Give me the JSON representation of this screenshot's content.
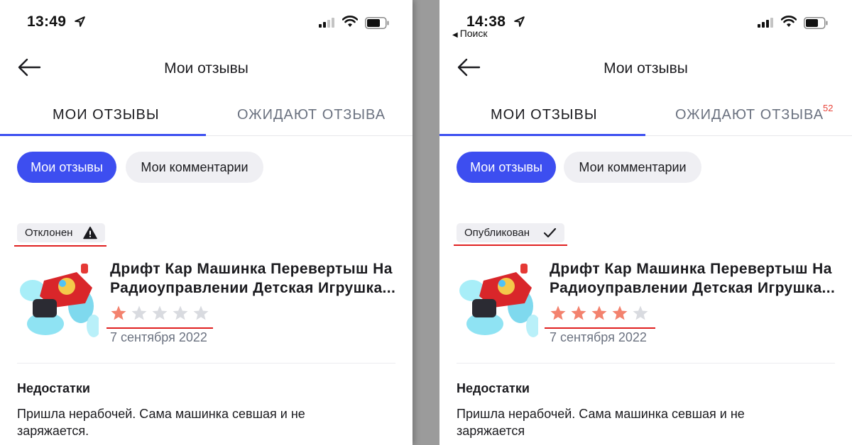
{
  "colors": {
    "accent": "#3d4ef0",
    "star_filled": "#f3826e",
    "star_empty": "#d9dbe0",
    "annotation_red": "#e02020",
    "badge_red": "#e8443a"
  },
  "screens": [
    {
      "status_bar": {
        "time": "13:49",
        "back_app": ""
      },
      "header": {
        "title": "Мои отзывы"
      },
      "tabs": [
        {
          "label": "Мои отзывы",
          "active": true
        },
        {
          "label": "Ожидают отзыва",
          "active": false,
          "badge": ""
        }
      ],
      "pills": [
        {
          "label": "Мои отзывы",
          "active": true
        },
        {
          "label": "Мои комментарии",
          "active": false
        }
      ],
      "review": {
        "status": "Отклонен",
        "status_icon": "warning-icon",
        "product_title": "Дрифт Кар Машинка Перевертыш На Радиоуправлении Детская Игрушка...",
        "rating": 1,
        "rating_max": 5,
        "date": "7 сентября 2022",
        "section_title": "Недостатки",
        "section_text": "Пришла нерабочей. Сама машинка севшая и не заряжается."
      }
    },
    {
      "status_bar": {
        "time": "14:38",
        "back_app": "Поиск"
      },
      "header": {
        "title": "Мои отзывы"
      },
      "tabs": [
        {
          "label": "Мои отзывы",
          "active": true
        },
        {
          "label": "Ожидают отзыва",
          "active": false,
          "badge": "52"
        }
      ],
      "pills": [
        {
          "label": "Мои отзывы",
          "active": true
        },
        {
          "label": "Мои комментарии",
          "active": false
        }
      ],
      "review": {
        "status": "Опубликован",
        "status_icon": "checkmark-icon",
        "product_title": "Дрифт Кар Машинка Перевертыш На Радиоуправлении Детская Игрушка...",
        "rating": 4,
        "rating_max": 5,
        "date": "7 сентября 2022",
        "section_title": "Недостатки",
        "section_text": "Пришла нерабочей. Сама машинка севшая и не заряжается"
      }
    }
  ]
}
